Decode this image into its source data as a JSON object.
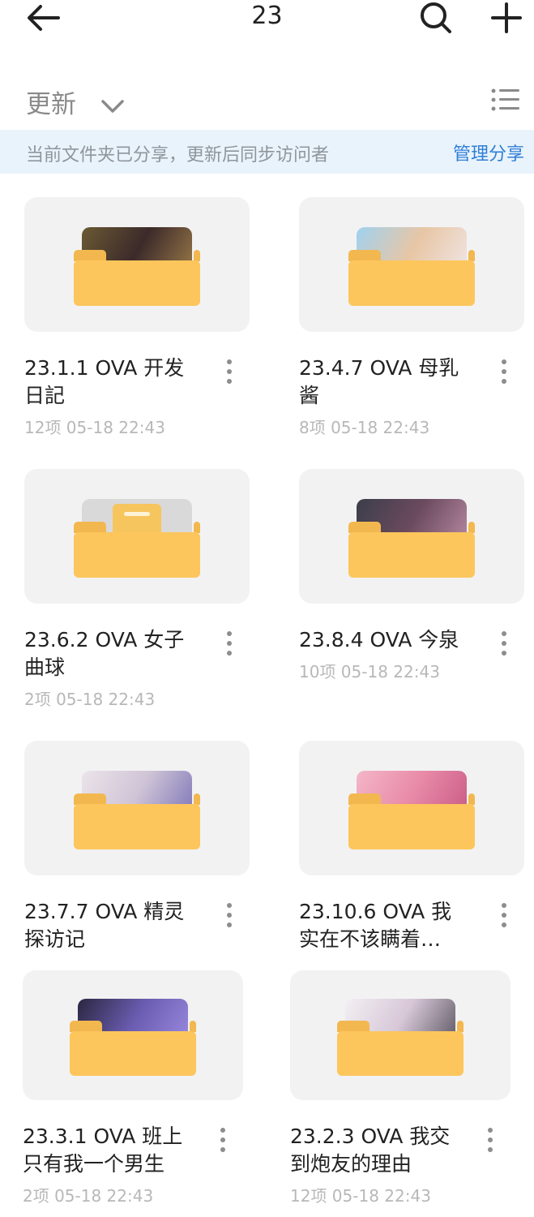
{
  "header": {
    "title": "23",
    "back_icon": "back-arrow-icon",
    "search_icon": "search-icon",
    "add_icon": "plus-icon"
  },
  "sort": {
    "label": "更新",
    "chevron_icon": "chevron-down-icon",
    "view_icon": "list-view-icon"
  },
  "share_banner": {
    "text": "当前文件夹已分享，更新后同步访问者",
    "action": "管理分享",
    "action_color": "#2f7fd6"
  },
  "folders": [
    {
      "line1": "23.1.1 OVA 开发",
      "line2": "日記",
      "meta": "12项  05-18 22:43",
      "preview_colors": [
        "#6b5a34",
        "#3c2a2a",
        "#9a7a49"
      ]
    },
    {
      "line1": "23.4.7 OVA 母乳",
      "line2": "酱",
      "meta": "8项  05-18 22:43",
      "preview_colors": [
        "#9fd2f0",
        "#e8c6a5",
        "#f0e6e6"
      ]
    },
    {
      "line1": "23.6.2 OVA 女子",
      "line2": "曲球",
      "meta": "2项  05-18 22:43",
      "preview_colors": []
    },
    {
      "line1": "23.8.4 OVA 今泉",
      "line2": "",
      "meta": "10项  05-18 22:43",
      "preview_colors": [
        "#3b3e4a",
        "#6b4a5e",
        "#b78aa2"
      ]
    },
    {
      "line1": "23.7.7 OVA 精灵",
      "line2": "探访记",
      "meta": "",
      "preview_colors": [
        "#ece4ea",
        "#cfc4d6",
        "#7d76b8"
      ]
    },
    {
      "line1": "23.10.6 OVA 我",
      "line2": "实在不该瞒着…",
      "meta": "",
      "preview_colors": [
        "#f4b6c8",
        "#e88aa8",
        "#c95a84"
      ]
    },
    {
      "line1": "23.3.1 OVA 班上",
      "line2": "只有我一个男生",
      "meta": "2项  05-18 22:43",
      "preview_colors": [
        "#2a2740",
        "#6a5cb0",
        "#9b8be0"
      ]
    },
    {
      "line1": "23.2.3 OVA 我交",
      "line2": "到炮友的理由",
      "meta": "12项  05-18 22:43",
      "preview_colors": [
        "#f3f0f3",
        "#d7c7d8",
        "#5b5560"
      ]
    }
  ],
  "folder_color": "#fcc65c",
  "more_icon": "more-vertical-icon"
}
